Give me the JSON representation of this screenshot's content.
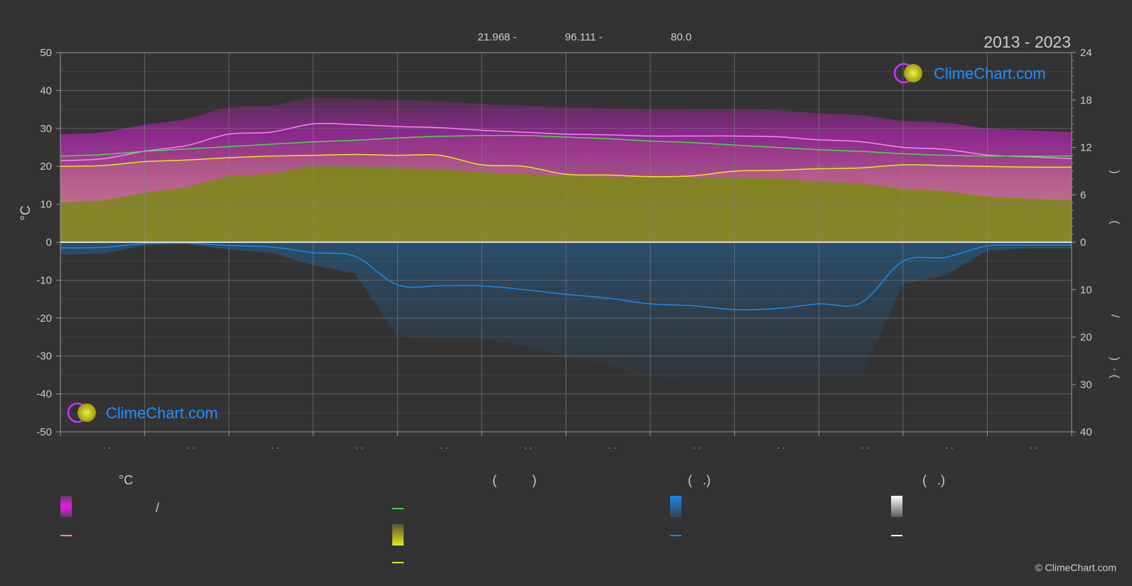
{
  "header": {
    "coords_lat": "21.968 -",
    "coords_lon": "96.111 -",
    "elevation": "80.0",
    "year_range": "2013 - 2023"
  },
  "brand": {
    "name": "ClimeChart.com",
    "copyright": "© ClimeChart.com",
    "color": "#1e90ff"
  },
  "chart_data": {
    "type": "line",
    "ylabel_left": "°C",
    "left_axis": {
      "ylim": [
        -50,
        50
      ],
      "ticks": [
        50,
        40,
        30,
        20,
        10,
        0,
        -10,
        -20,
        -30,
        -40,
        -50
      ]
    },
    "right_axis_sun": {
      "ylim": [
        0,
        24
      ],
      "ticks": [
        24,
        18,
        12,
        6,
        0
      ]
    },
    "right_axis_precip": {
      "ylim": [
        0,
        40
      ],
      "ticks": [
        10,
        20,
        30,
        40
      ]
    },
    "right_axis_glyphs": [
      ")",
      "(",
      "/",
      ")",
      "(",
      "·"
    ],
    "month_ticks": [
      "· ·",
      "· ·",
      "· ·",
      "· ·",
      "· ·",
      "· ·",
      "· ·",
      "· ·",
      "· ·",
      "· ·",
      "· ·",
      "· ·"
    ],
    "x": [
      0,
      0.5,
      1,
      1.5,
      2,
      2.5,
      3,
      3.5,
      4,
      4.5,
      5,
      5.5,
      6,
      6.5,
      7,
      7.5,
      8,
      8.5,
      9,
      9.5,
      10,
      10.5,
      11,
      11.5,
      12
    ],
    "series": [
      {
        "key": "temp_max_avg",
        "color": "#ff80ff",
        "values": [
          21.5,
          22.0,
          24.0,
          25.5,
          28.5,
          29.0,
          31.2,
          31.0,
          30.5,
          30.2,
          29.5,
          29.0,
          28.5,
          28.3,
          28.0,
          28.0,
          28.0,
          27.8,
          27.0,
          26.5,
          25.0,
          24.5,
          23.0,
          22.5,
          22.0
        ]
      },
      {
        "key": "daylight_hours",
        "color": "#44dd44",
        "axis": "sun",
        "values": [
          10.9,
          11.1,
          11.5,
          11.8,
          12.1,
          12.4,
          12.7,
          12.9,
          13.2,
          13.4,
          13.5,
          13.5,
          13.3,
          13.1,
          12.8,
          12.6,
          12.3,
          12.0,
          11.7,
          11.5,
          11.2,
          11.0,
          10.9,
          10.9,
          10.9
        ]
      },
      {
        "key": "sunshine_hours",
        "color": "#e6e61e",
        "axis": "sun",
        "values": [
          9.6,
          9.7,
          10.2,
          10.4,
          10.7,
          10.9,
          11.0,
          11.1,
          11.0,
          11.0,
          9.8,
          9.6,
          8.6,
          8.5,
          8.3,
          8.4,
          9.0,
          9.1,
          9.3,
          9.4,
          9.8,
          9.7,
          9.6,
          9.5,
          9.5
        ]
      },
      {
        "key": "precipitation",
        "color": "#1e88e5",
        "axis": "precip",
        "values": [
          1.2,
          1.1,
          0.3,
          0.2,
          0.7,
          1.0,
          2.2,
          3.0,
          9.0,
          9.2,
          9.2,
          10.0,
          11.0,
          11.8,
          13.0,
          13.4,
          14.2,
          14.0,
          13.0,
          12.8,
          4.0,
          3.2,
          0.8,
          0.6,
          0.6
        ]
      }
    ]
  },
  "legend": {
    "col1_header": "°C",
    "col1_row1_sep": "/",
    "col2_header": "(          )",
    "col3_header": "(   .)",
    "col4_header": "(   .)",
    "colors": {
      "temp_range": "#e020e0",
      "temp_line": "#ff80ff",
      "daylight_line": "#44dd44",
      "sunshine_fill": "#e6e61e",
      "sunshine_line": "#e6e61e",
      "precip_fill": "#1e88e5",
      "precip_line": "#1e88e5",
      "snow_fill": "#dddddd",
      "snow_line": "#ffffff"
    }
  }
}
